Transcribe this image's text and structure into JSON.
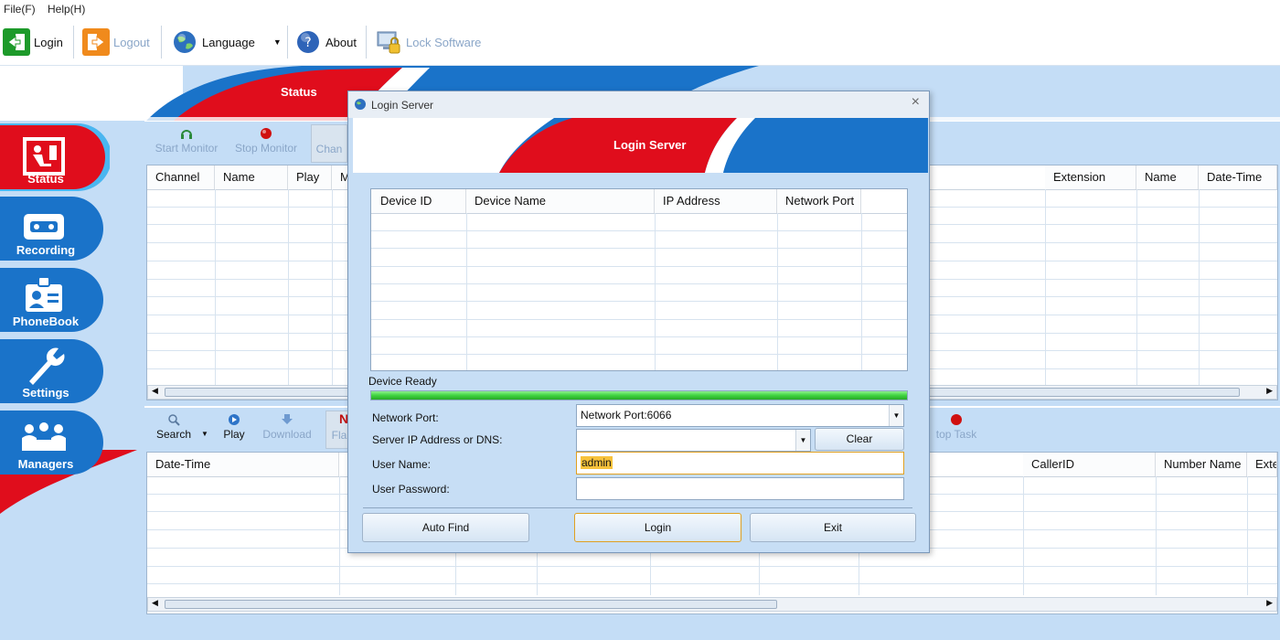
{
  "menu": {
    "file": "File(F)",
    "help": "Help(H)"
  },
  "toolbar": {
    "login": "Login",
    "logout": "Logout",
    "language": "Language",
    "about": "About",
    "lock": "Lock Software"
  },
  "header": {
    "status_tab": "Status"
  },
  "sidebar": {
    "items": [
      {
        "label": "Status"
      },
      {
        "label": "Recording"
      },
      {
        "label": "PhoneBook"
      },
      {
        "label": "Settings"
      },
      {
        "label": "Managers"
      }
    ]
  },
  "top_panel": {
    "start_monitor": "Start Monitor",
    "stop_monitor": "Stop Monitor",
    "channel_btn": "Chan",
    "columns": [
      "Channel",
      "Name",
      "Play",
      "M",
      "Extension",
      "Name",
      "Date-Time"
    ]
  },
  "bottom_panel": {
    "search": "Search",
    "play": "Play",
    "download": "Download",
    "flag": "Fla",
    "stop_task": "top Task",
    "columns": [
      "Date-Time",
      "CallerID",
      "Number Name",
      "Exte"
    ]
  },
  "dialog": {
    "title": "Login Server",
    "banner": "Login Server",
    "columns": [
      "Device ID",
      "Device Name",
      "IP Address",
      "Network Port"
    ],
    "status_text": "Device Ready",
    "progress": 1.0,
    "network_port_label": "Network Port:",
    "network_port_value": "Network Port:6066",
    "server_label": "Server IP Address or DNS:",
    "server_value": "",
    "clear": "Clear",
    "username_label": "User Name:",
    "username_value": "admin",
    "password_label": "User Password:",
    "password_value": "",
    "auto_find": "Auto Find",
    "login": "Login",
    "exit": "Exit",
    "close_glyph": "×"
  },
  "colors": {
    "accent_red": "#e00d1c",
    "accent_blue": "#1a73c9",
    "progress_green": "#3fd43f"
  }
}
